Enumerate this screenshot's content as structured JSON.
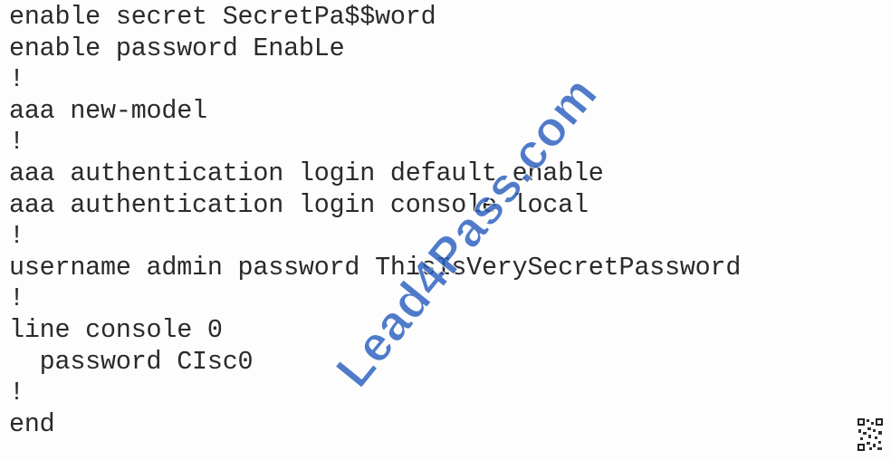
{
  "config_lines": [
    "enable secret SecretPa$$word",
    "enable password EnabLe",
    "!",
    "aaa new-model",
    "!",
    "aaa authentication login default enable",
    "aaa authentication login console local",
    "!",
    "username admin password ThisIsVerySecretPassword",
    "!",
    "line console 0",
    "  password CIsc0",
    "!",
    "end"
  ],
  "watermark": {
    "text": "Lead4Pass.com",
    "color": "#2b5fbf"
  },
  "qr_icon": "qr-code-icon"
}
